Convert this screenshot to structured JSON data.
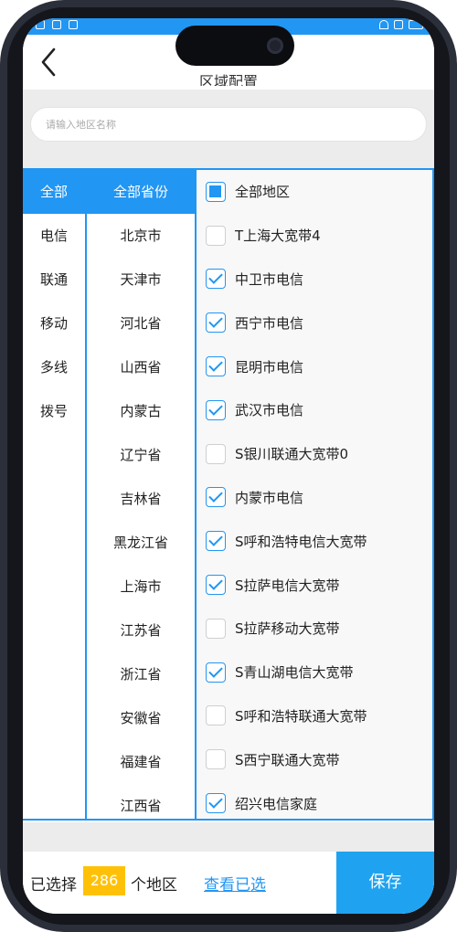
{
  "header": {
    "title": "区域配置",
    "back_icon": "chevron-left-icon"
  },
  "search": {
    "placeholder": "请输入地区名称",
    "value": ""
  },
  "carriers": {
    "items": [
      "全部",
      "电信",
      "联通",
      "移动",
      "多线",
      "拨号"
    ],
    "selected": "全部"
  },
  "provinces": {
    "items": [
      "全部省份",
      "北京市",
      "天津市",
      "河北省",
      "山西省",
      "内蒙古",
      "辽宁省",
      "吉林省",
      "黑龙江省",
      "上海市",
      "江苏省",
      "浙江省",
      "安徽省",
      "福建省",
      "江西省"
    ],
    "selected": "全部省份"
  },
  "regions": [
    {
      "label": "全部地区",
      "state": "partial"
    },
    {
      "label": "T上海大宽带4",
      "state": "off"
    },
    {
      "label": "中卫市电信",
      "state": "on"
    },
    {
      "label": "西宁市电信",
      "state": "on"
    },
    {
      "label": "昆明市电信",
      "state": "on"
    },
    {
      "label": "武汉市电信",
      "state": "on"
    },
    {
      "label": "S银川联通大宽带0",
      "state": "off"
    },
    {
      "label": "内蒙市电信",
      "state": "on"
    },
    {
      "label": "S呼和浩特电信大宽带",
      "state": "on"
    },
    {
      "label": "S拉萨电信大宽带",
      "state": "on"
    },
    {
      "label": "S拉萨移动大宽带",
      "state": "off"
    },
    {
      "label": "S青山湖电信大宽带",
      "state": "on"
    },
    {
      "label": "S呼和浩特联通大宽带",
      "state": "off"
    },
    {
      "label": "S西宁联通大宽带",
      "state": "off"
    },
    {
      "label": "绍兴电信家庭",
      "state": "on"
    }
  ],
  "footer": {
    "selected_prefix": "已选择",
    "selected_count": "286",
    "selected_suffix": "个地区",
    "view_link": "查看已选",
    "save_label": "保存"
  },
  "colors": {
    "accent": "#2196F3",
    "count_badge": "#FFC107",
    "save_button": "#1FA3F0"
  }
}
